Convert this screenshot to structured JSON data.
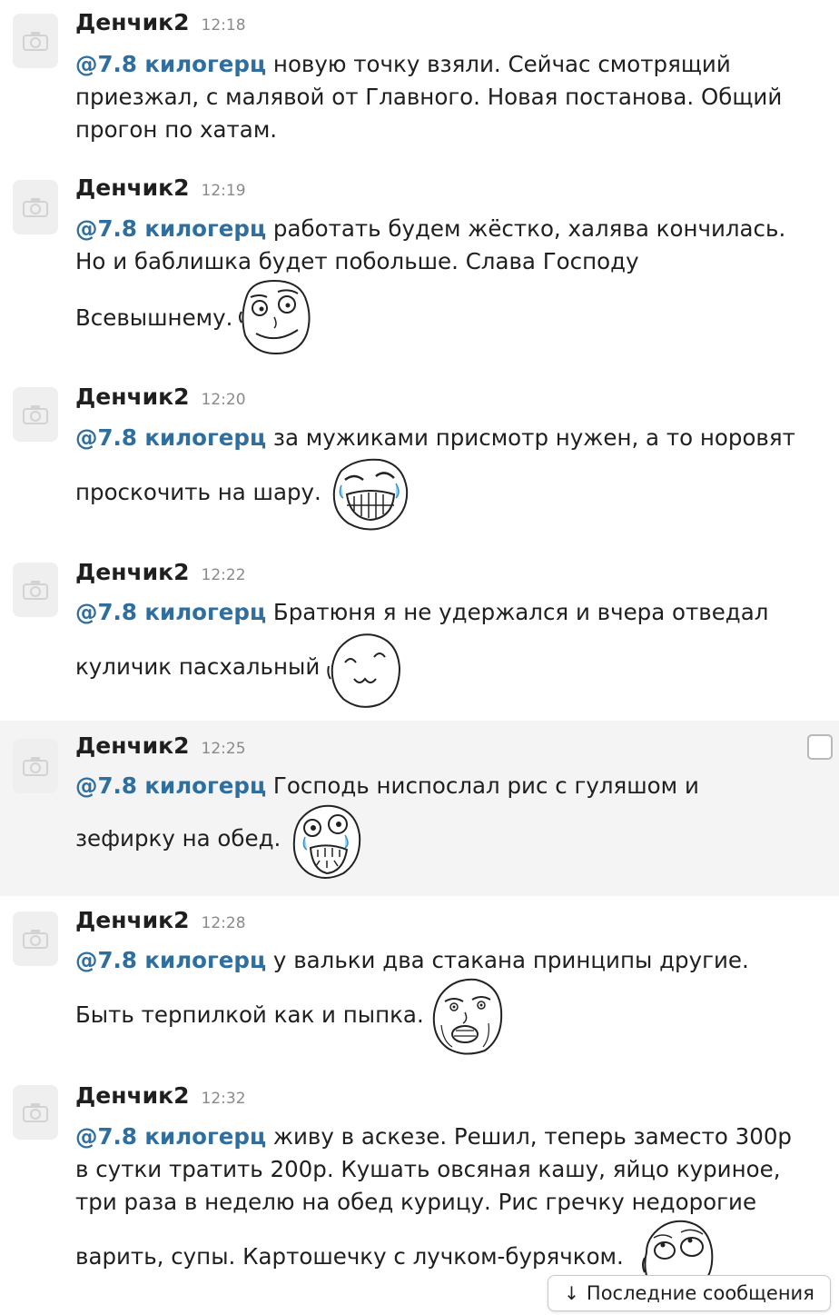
{
  "mention": "@7.8 килогерц",
  "latest_button": {
    "label": "Последние сообщения",
    "icon": "arrow-down-icon"
  },
  "messages": [
    {
      "author": "Денчик2",
      "time": "12:18",
      "lines": [
        "новую точку взяли. Сейчас смотрящий",
        "приезжал, с малявой от Главного. Новая постанова. Общий",
        "прогон по хатам."
      ]
    },
    {
      "author": "Денчик2",
      "time": "12:19",
      "lines": [
        "работать будем жёстко, халява кончилась.",
        "Но и баблишка будет побольше. Слава Господу",
        "Всевышнему."
      ],
      "sticker": "smug-rage-face"
    },
    {
      "author": "Денчик2",
      "time": "12:20",
      "lines": [
        "за мужиками присмотр нужен, а то норовят",
        "проскочить на шару."
      ],
      "sticker": "laughing-tears-rage-face"
    },
    {
      "author": "Денчик2",
      "time": "12:22",
      "lines": [
        "Братюня я не удержался и вчера отведал",
        "куличик пасхальный"
      ],
      "sticker": "cute-cat-mouth-face"
    },
    {
      "author": "Денчик2",
      "time": "12:25",
      "lines": [
        "Господь ниспослал рис с гуляшом и",
        "зефирку на обед."
      ],
      "sticker": "happy-tears-rage-face"
    },
    {
      "author": "Денчик2",
      "time": "12:28",
      "lines": [
        "у вальки два стакана принципы другие.",
        "Быть терпилкой как и пыпка."
      ],
      "sticker": "concerned-rage-face"
    },
    {
      "author": "Денчик2",
      "time": "12:32",
      "lines": [
        "живу в аскезе. Решил, теперь заместо 300р",
        "в сутки тратить 200р. Кушать овсяная кашу, яйцо куриное,",
        "три раза в неделю на обед курицу. Рис гречку недорогие",
        "варить, супы. Картошечку с лучком-бурячком."
      ],
      "sticker": "rolling-eyes-rage-face"
    }
  ]
}
